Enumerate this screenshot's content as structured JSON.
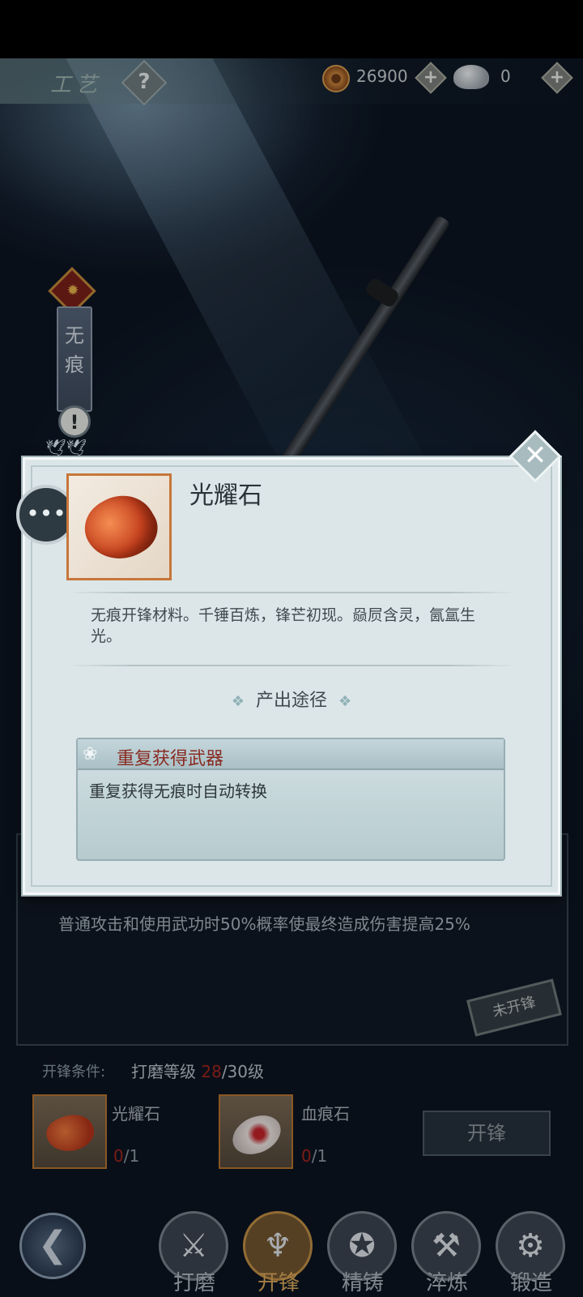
{
  "header": {
    "title": "工艺",
    "help_glyph": "?",
    "copper_coins": "26900",
    "silver": "0",
    "plus": "+"
  },
  "weapon_banner": {
    "name_line1": "无",
    "name_line2": "痕",
    "alert": "!"
  },
  "base_page": {
    "effect": "普通攻击和使用武功时50%概率使最终造成伤害提高25%",
    "stamp": "未开锋",
    "condition_label": "开锋条件:",
    "condition_name": "打磨等级",
    "condition_current": "28",
    "condition_target": "/30级",
    "materials": [
      {
        "name": "光耀石",
        "have": "0",
        "need": "/1"
      },
      {
        "name": "血痕石",
        "have": "0",
        "need": "/1"
      }
    ],
    "action_button": "开锋"
  },
  "nav": {
    "back_glyph": "❮",
    "tabs": [
      {
        "label": "打磨",
        "active": false
      },
      {
        "label": "开锋",
        "active": true
      },
      {
        "label": "精铸",
        "active": false
      },
      {
        "label": "淬炼",
        "active": false
      },
      {
        "label": "锻造",
        "active": false
      }
    ]
  },
  "dialog": {
    "item_name": "光耀石",
    "description": "无痕开锋材料。千锤百炼，锋芒初现。赑屃含灵，氤氲生光。",
    "source_section": "产出途径",
    "source_title": "重复获得武器",
    "source_desc": "重复获得无痕时自动转换",
    "close_glyph": "✕",
    "chat_glyph": "•••"
  },
  "colors": {
    "dialog_bg": "#dce6e8",
    "item_border": "#c7763a",
    "source_title": "#8a2b22",
    "active_tab": "#d9a85b",
    "requirement_red": "#a3241c"
  }
}
